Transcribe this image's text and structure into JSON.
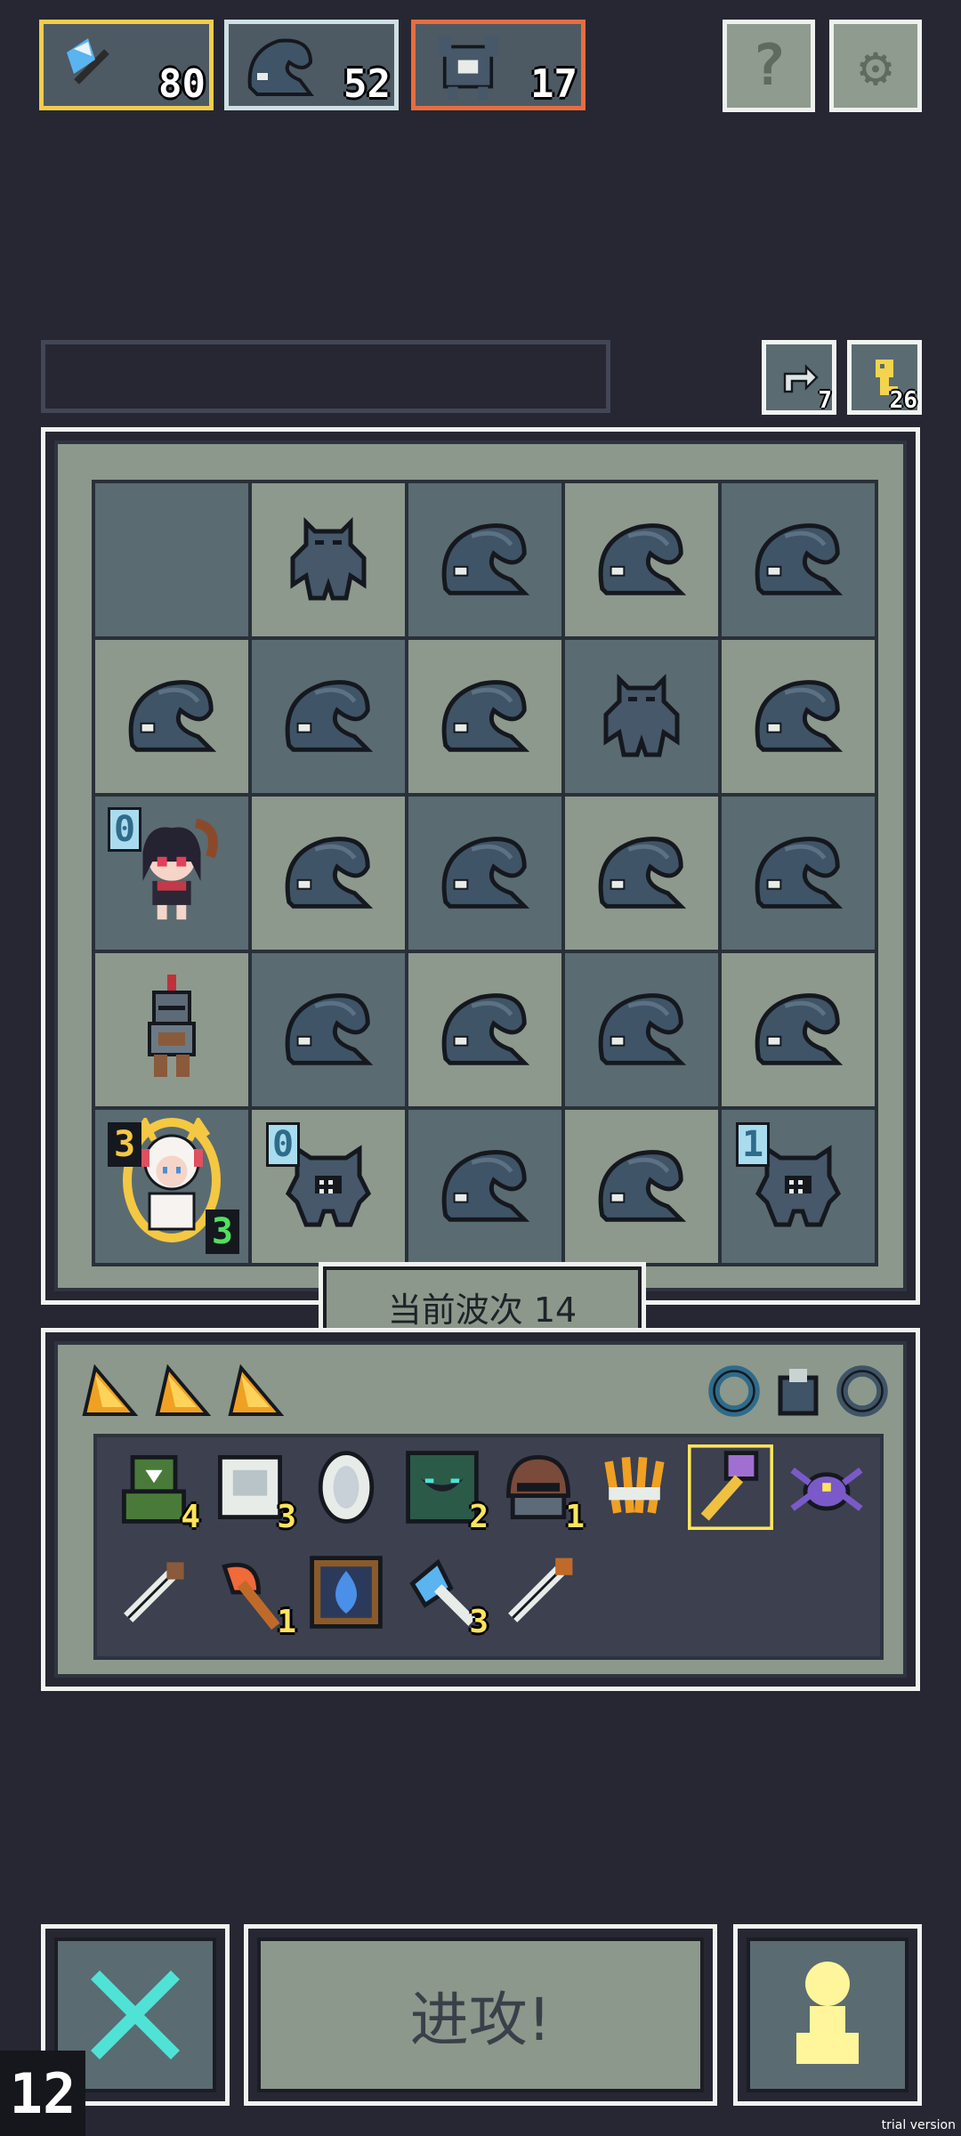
{
  "resources": [
    {
      "name": "axe-resource-icon",
      "count": "80"
    },
    {
      "name": "slug-resource-icon",
      "count": "52"
    },
    {
      "name": "beast-resource-icon",
      "count": "17"
    }
  ],
  "top_buttons": {
    "help_glyph": "?",
    "settings_glyph": "⚙"
  },
  "counters": {
    "recycle_count": "7",
    "key_count": "26"
  },
  "board": {
    "cells": [
      [
        "empty",
        "gargoyle",
        "slug",
        "slug",
        "slug"
      ],
      [
        "slug",
        "slug",
        "slug",
        "gargoyle",
        "slug"
      ],
      [
        "demon-girl",
        "slug",
        "slug",
        "slug",
        "slug"
      ],
      [
        "knight",
        "slug",
        "slug",
        "slug",
        "slug"
      ],
      [
        "angel-girl",
        "beast",
        "slug",
        "slug",
        "beast"
      ]
    ],
    "badges": {
      "demon_girl_level": "0",
      "angel_girl_level": "3",
      "angel_girl_power": "3",
      "beast_left_level": "0",
      "beast_right_level": "1"
    }
  },
  "wave": {
    "label": "当前波次 14"
  },
  "inventory": {
    "row1": [
      {
        "icon": "goblin-icon",
        "count": "4"
      },
      {
        "icon": "scroll-icon",
        "count": "3"
      },
      {
        "icon": "egg-icon",
        "count": ""
      },
      {
        "icon": "mask-card-icon",
        "count": "2"
      },
      {
        "icon": "helmet-icon",
        "count": "1"
      },
      {
        "icon": "claws-icon",
        "count": ""
      },
      {
        "icon": "magic-key-icon",
        "count": ""
      },
      {
        "icon": "spider-icon",
        "count": ""
      }
    ],
    "row2": [
      {
        "icon": "dagger-icon",
        "count": ""
      },
      {
        "icon": "fire-axe-icon",
        "count": "1"
      },
      {
        "icon": "water-drop-card-icon",
        "count": ""
      },
      {
        "icon": "blue-axe-icon",
        "count": "3"
      },
      {
        "icon": "sword-icon",
        "count": ""
      }
    ]
  },
  "bottom": {
    "attack_label": "进攻!",
    "level_number": "12",
    "watermark": "trial version"
  },
  "colors": {
    "background": "#262732",
    "panel": "#8b988b",
    "cell_dark": "#5a6b72",
    "slug": "#3f5466",
    "gold": "#ffe45c",
    "cyan_x": "#4fe3d6"
  }
}
